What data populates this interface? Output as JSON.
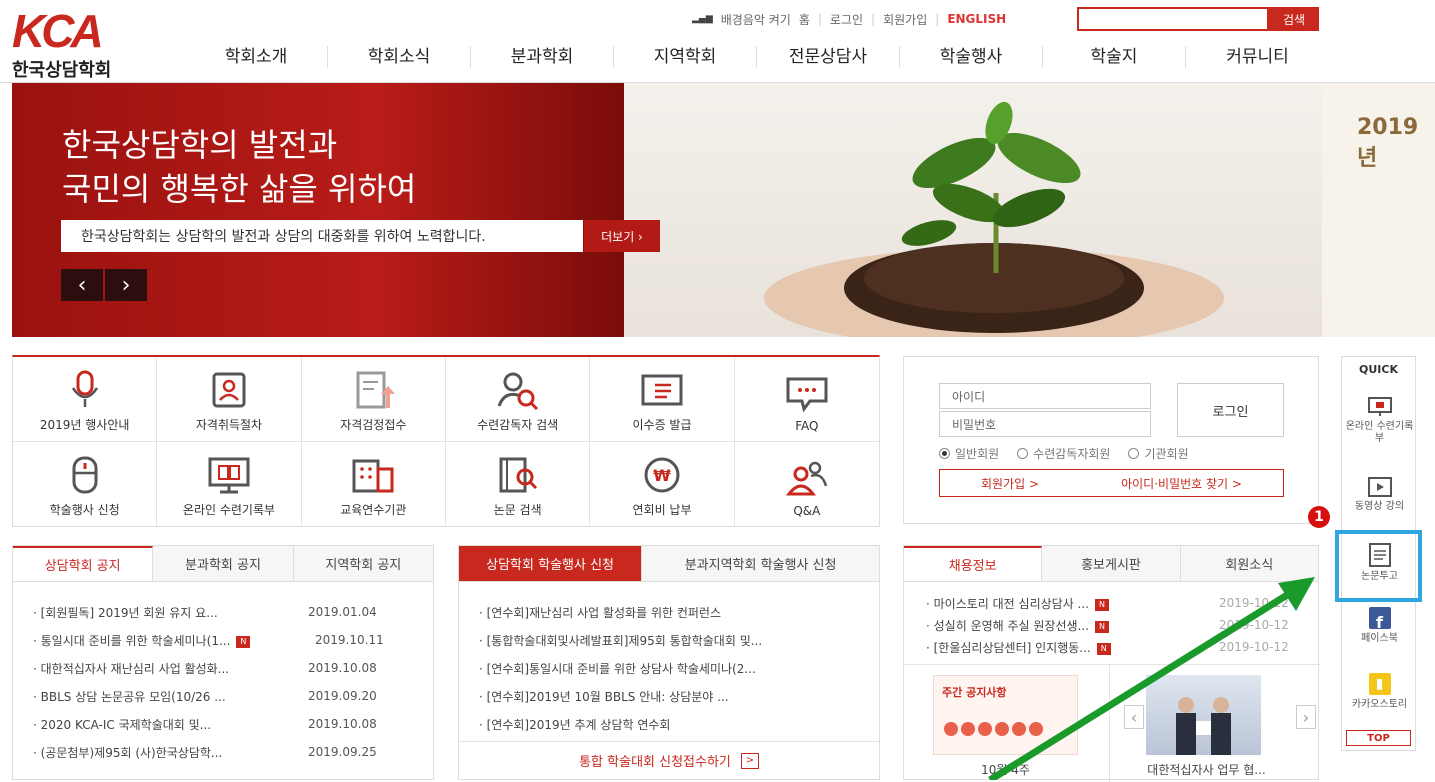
{
  "header": {
    "logo_mark": "KCA",
    "logo_name": "한국상담학회",
    "util": [
      "배경음악 켜기",
      "홈",
      "로그인",
      "회원가입",
      "ENGLISH"
    ],
    "search_button": "검색",
    "nav": [
      "학회소개",
      "학회소식",
      "분과학회",
      "지역학회",
      "전문상담사",
      "학술행사",
      "학술지",
      "커뮤니티"
    ]
  },
  "banner": {
    "title_line1": "한국상담학의 발전과",
    "title_line2": "국민의 행복한 삶을 위하여",
    "subtitle": "한국상담학회는 상담학의 발전과 상담의 대중화를 위하여 노력합니다.",
    "more": "더보기 ›",
    "prev": "‹",
    "next": "›",
    "peek_text": "2019년"
  },
  "quick_menu": [
    {
      "label": "2019년 행사안내",
      "icon": "microphone-icon"
    },
    {
      "label": "자격취득절차",
      "icon": "id-card-icon"
    },
    {
      "label": "자격검정접수",
      "icon": "document-upload-icon"
    },
    {
      "label": "수련감독자 검색",
      "icon": "person-search-icon"
    },
    {
      "label": "이수증 발급",
      "icon": "certificate-icon"
    },
    {
      "label": "FAQ",
      "icon": "chat-bubble-icon"
    },
    {
      "label": "학술행사 신청",
      "icon": "mouse-icon"
    },
    {
      "label": "온라인 수련기록부",
      "icon": "monitor-book-icon"
    },
    {
      "label": "교육연수기관",
      "icon": "building-icon"
    },
    {
      "label": "논문 검색",
      "icon": "paper-search-icon"
    },
    {
      "label": "연회비 납부",
      "icon": "won-coin-icon"
    },
    {
      "label": "Q&A",
      "icon": "people-icon"
    }
  ],
  "login": {
    "id_placeholder": "아이디",
    "pw_placeholder": "비밀번호",
    "login_button": "로그인",
    "radios": [
      "일반회원",
      "수련감독자회원",
      "기관회원"
    ],
    "join": "회원가입  >",
    "find": "아이디·비밀번호 찾기  >"
  },
  "board1": {
    "tabs": [
      "상담학회 공지",
      "분과학회 공지",
      "지역학회 공지"
    ],
    "items": [
      {
        "title": "· [회원필독] 2019년 회원 유지 요...",
        "date": "2019.01.04",
        "new": false
      },
      {
        "title": "· 통일시대 준비를 위한 학술세미나(1...",
        "date": "2019.10.11",
        "new": true
      },
      {
        "title": "· 대한적십자사 재난심리 사업 활성화...",
        "date": "2019.10.08",
        "new": false
      },
      {
        "title": "· BBLS 상담 논문공유 모임(10/26 ...",
        "date": "2019.09.20",
        "new": false
      },
      {
        "title": "· 2020 KCA-IC 국제학술대회 및...",
        "date": "2019.10.08",
        "new": false
      },
      {
        "title": "· (공문첨부)제95회 (사)한국상담학...",
        "date": "2019.09.25",
        "new": false
      }
    ]
  },
  "board2": {
    "tabs": [
      "상담학회 학술행사 신청",
      "분과지역학회 학술행사 신청"
    ],
    "items": [
      "· [연수회]재난심리 사업 활성화를 위한 컨퍼런스",
      "· [통합학술대회및사례발표회]제95회 통합학술대회 및...",
      "· [연수회]통일시대 준비를 위한 상담사 학술세미나(2...",
      "· [연수회]2019년 10월 BBLS 안내: 상담분야 ...",
      "· [연수회]2019년 추계 상담학 연수회"
    ],
    "cta": "통합 학술대회 신청접수하기",
    "cta_arrow": ">"
  },
  "board3": {
    "tabs": [
      "채용정보",
      "홍보게시판",
      "회원소식"
    ],
    "items": [
      {
        "title": "· 마이스토리 대전 심리상담사 ...",
        "date": "2019-10-12"
      },
      {
        "title": "· 성실히 운영해 주실 원장선생...",
        "date": "2019-10-12"
      },
      {
        "title": "· [한울심리상담센터] 인지행동...",
        "date": "2019-10-12"
      }
    ],
    "card1_title": "주간 공지사항",
    "card1_caption": "10월 4주",
    "card2_caption": "대한적십자사 업무 협...",
    "prev": "‹",
    "next": "›"
  },
  "quick": {
    "title": "QUICK",
    "items": [
      {
        "label": "온라인 수련기록부",
        "icon": "monitor-icon"
      },
      {
        "label": "동영상 강의",
        "icon": "video-icon"
      },
      {
        "label": "논문투고",
        "icon": "document-icon"
      },
      {
        "label": "페이스북",
        "icon": "facebook-icon"
      },
      {
        "label": "카카오스토리",
        "icon": "kakaostory-icon"
      }
    ],
    "top": "TOP"
  },
  "annotation": {
    "marker": "1",
    "highlight_color": "#2ea6e0",
    "arrow_color": "#1a9a2a",
    "marker_color": "#d80f0f"
  },
  "colors": {
    "brand": "#c8281e"
  }
}
